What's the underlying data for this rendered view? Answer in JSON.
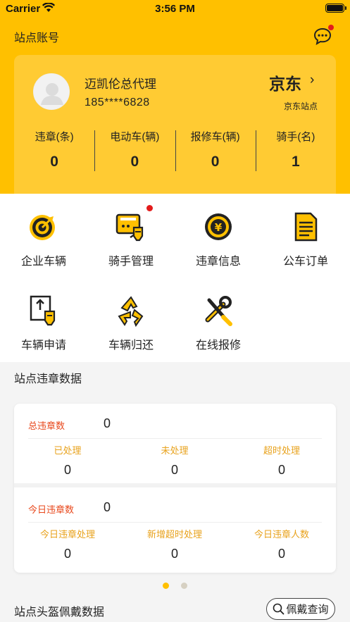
{
  "status_bar": {
    "carrier": "Carrier",
    "time": "3:56 PM"
  },
  "nav": {
    "title": "站点账号",
    "message_icon": "chat-bubble-icon"
  },
  "profile": {
    "name": "迈凯伦总代理",
    "phone": "185****6828",
    "brand": "京东",
    "brand_chevron": "›",
    "site": "京东站点"
  },
  "stats": [
    {
      "label": "违章(条)",
      "value": "0"
    },
    {
      "label": "电动车(辆)",
      "value": "0"
    },
    {
      "label": "报修车(辆)",
      "value": "0"
    },
    {
      "label": "骑手(名)",
      "value": "1"
    }
  ],
  "menu": [
    {
      "label": "企业车辆",
      "icon": "scooter-target-icon",
      "badge": false
    },
    {
      "label": "骑手管理",
      "icon": "rider-manage-icon",
      "badge": true
    },
    {
      "label": "违章信息",
      "icon": "violation-coin-icon",
      "badge": false
    },
    {
      "label": "公车订单",
      "icon": "order-document-icon",
      "badge": false
    },
    {
      "label": "车辆申请",
      "icon": "vehicle-apply-icon",
      "badge": false
    },
    {
      "label": "车辆归还",
      "icon": "recycle-icon",
      "badge": false
    },
    {
      "label": "在线报修",
      "icon": "wrench-screwdriver-icon",
      "badge": false
    }
  ],
  "violation_section": {
    "title": "站点违章数据",
    "total": {
      "label": "总违章数",
      "value": "0"
    },
    "total_breakdown": [
      {
        "label": "已处理",
        "value": "0"
      },
      {
        "label": "未处理",
        "value": "0"
      },
      {
        "label": "超时处理",
        "value": "0"
      }
    ],
    "today": {
      "label": "今日违章数",
      "value": "0"
    },
    "today_breakdown": [
      {
        "label": "今日违章处理",
        "value": "0"
      },
      {
        "label": "新增超时处理",
        "value": "0"
      },
      {
        "label": "今日违章人数",
        "value": "0"
      }
    ]
  },
  "pager": {
    "active_color": "#FFC000",
    "inactive_color": "#d6d0c2"
  },
  "helmet_section": {
    "title": "站点头盔佩戴数据",
    "query_button": "佩戴查询"
  },
  "colors": {
    "brand_yellow": "#FFC000",
    "accent_orange": "#E8481C",
    "label_gold": "#E8A21C",
    "badge_red": "#e31b1b"
  }
}
